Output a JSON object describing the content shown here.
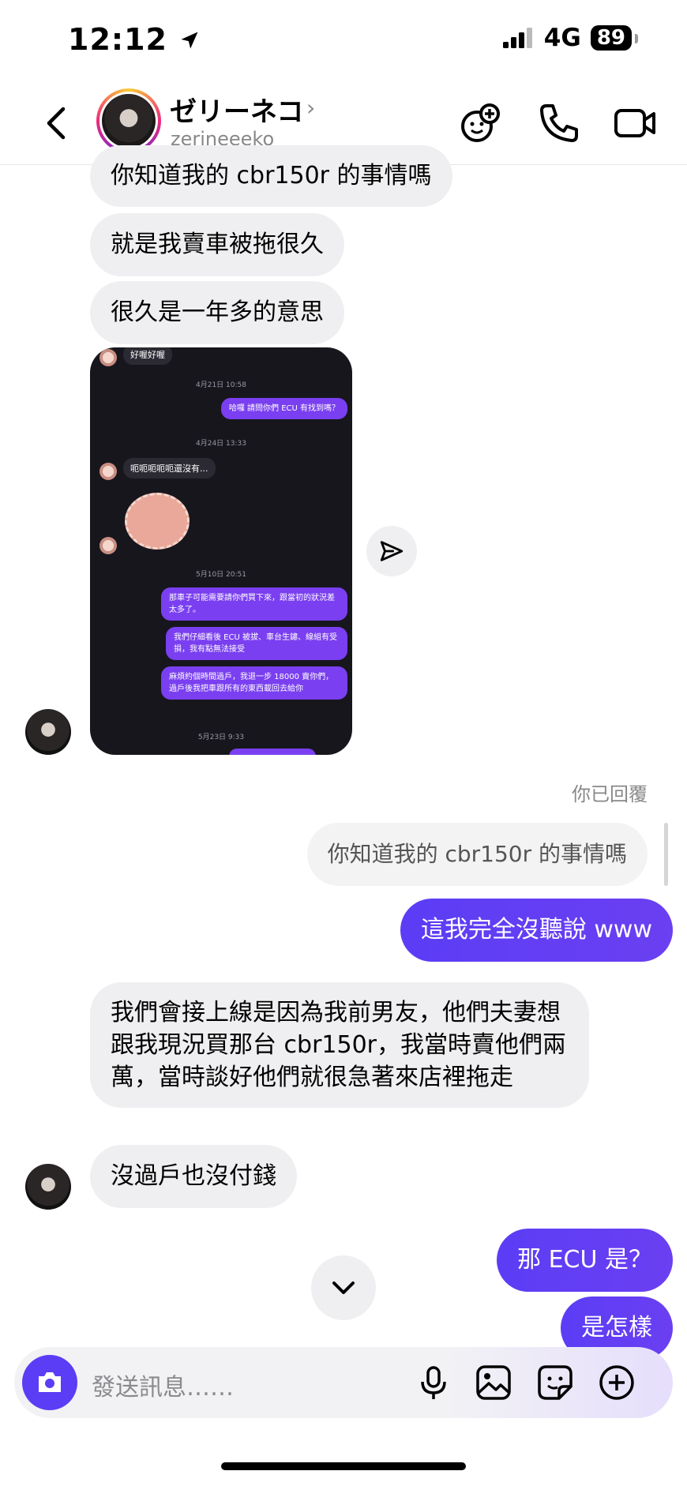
{
  "status_bar": {
    "time": "12:12",
    "network": "4G",
    "battery": "89"
  },
  "header": {
    "name": "ゼリーネコ",
    "username": "zerineeeko"
  },
  "messages": {
    "in1": "你知道我的 cbr150r 的事情嗎",
    "in2": "就是我賣車被拖很久",
    "in3": "很久是一年多的意思",
    "in_long": "我們會接上線是因為我前男友，他們夫妻想跟我現況買那台 cbr150r，我當時賣他們兩萬，當時談好他們就很急著來店裡拖走",
    "in_last": "沒過戶也沒付錢",
    "out1": "這我完全沒聽說 www",
    "out2": "那 ECU 是？",
    "out3": "是怎樣"
  },
  "reply": {
    "label": "你已回覆",
    "quoted": "你知道我的 cbr150r 的事情嗎"
  },
  "screenshot": {
    "top_in": "好喔好喔",
    "date1": "4月21日 10:58",
    "out1": "哈囉 請問你們 ECU 有找到嗎？",
    "date2": "4月24日 13:33",
    "in1": "呃呃呃呃呃還沒有...",
    "date3": "5月10日 20:51",
    "out2": "那車子可能需要請你們買下來，跟當初的狀況差太多了。",
    "out3": "我們仔細看後 ECU 被拔、車台生鏽、線組有受損，我有點無法接受",
    "out4": "麻煩約個時間過戶，我退一步 18000 賣你們，過戶後我把車跟所有的東西載回去給你",
    "date4": "5月23日 9:33"
  },
  "composer": {
    "placeholder": "發送訊息……"
  },
  "colors": {
    "accent": "#5b3df5",
    "incoming": "#efeff1"
  },
  "icons": [
    "back-chevron-icon",
    "effects-icon",
    "phone-icon",
    "video-icon",
    "send-icon",
    "chevron-down-icon",
    "camera-icon",
    "mic-icon",
    "gallery-icon",
    "sticker-icon",
    "plus-icon"
  ]
}
